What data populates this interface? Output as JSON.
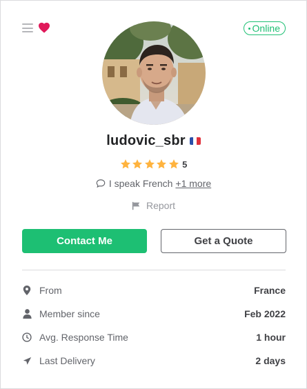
{
  "header": {
    "menu_icon": "hamburger-menu-icon",
    "favorite_icon": "heart-icon",
    "status": "Online"
  },
  "profile": {
    "username": "ludovic_sbr",
    "country_flag": "france-flag-icon",
    "rating": "5",
    "stars": 5,
    "languages_text": "I speak French",
    "languages_more": "+1 more",
    "report_label": "Report"
  },
  "actions": {
    "contact_label": "Contact Me",
    "quote_label": "Get a Quote"
  },
  "stats": [
    {
      "icon": "location-pin-icon",
      "label": "From",
      "value": "France"
    },
    {
      "icon": "user-icon",
      "label": "Member since",
      "value": "Feb 2022"
    },
    {
      "icon": "clock-icon",
      "label": "Avg. Response Time",
      "value": "1 hour"
    },
    {
      "icon": "paper-plane-icon",
      "label": "Last Delivery",
      "value": "2 days"
    }
  ],
  "colors": {
    "accent_green": "#1dbf73",
    "heart_red": "#e0195a",
    "star_yellow": "#ffb33e",
    "text_dark": "#404145"
  }
}
